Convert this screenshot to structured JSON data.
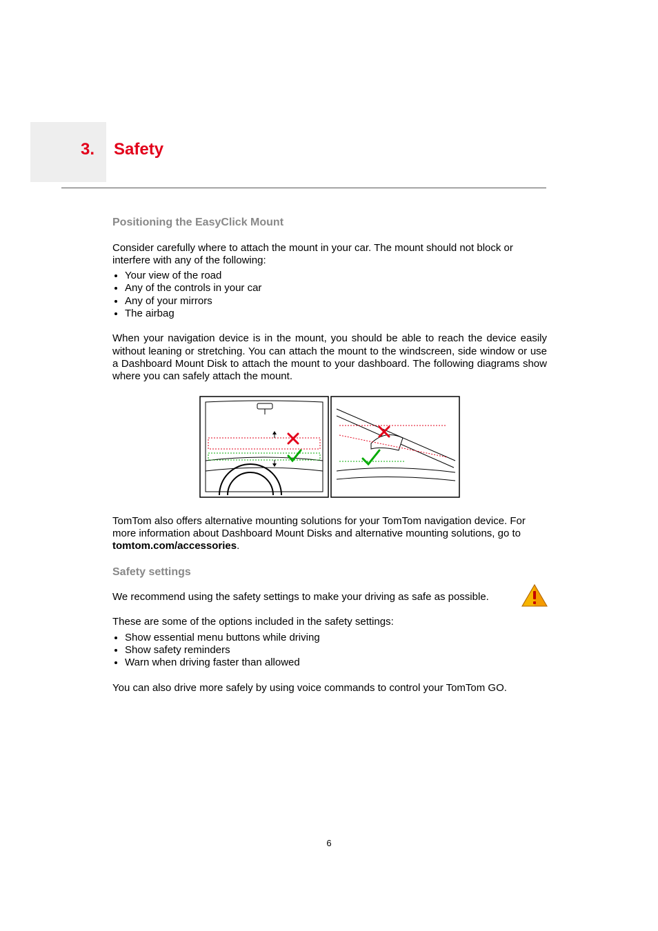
{
  "chapter": {
    "number": "3.",
    "title": "Safety"
  },
  "section1": {
    "heading": "Positioning the EasyClick Mount",
    "intro": "Consider carefully where to attach the mount in your car. The mount should not block or interfere with any of the following:",
    "bullets": [
      "Your view of the road",
      "Any of the controls in your car",
      "Any of your mirrors",
      "The airbag"
    ],
    "body": "When your navigation device is in the mount, you should be able to reach the device easily without leaning or stretching. You can attach the mount to the windscreen, side window or use a Dashboard Mount Disk to attach the mount to your dashboard. The following diagrams show where you can safely attach the mount.",
    "outro_prefix": "TomTom also offers alternative mounting solutions for your TomTom navigation device. For more information about Dashboard Mount Disks and alternative mounting solutions, go to ",
    "outro_link": "tomtom.com/accessories",
    "outro_suffix": "."
  },
  "section2": {
    "heading": "Safety settings",
    "intro": "We recommend using the safety settings to make your driving as safe as possible.",
    "options_intro": "These are some of the options included in the safety settings:",
    "bullets": [
      "Show essential menu buttons while driving",
      "Show safety reminders",
      "Warn when driving faster than allowed"
    ],
    "outro": "You can also drive more safely by using voice commands to control your TomTom GO."
  },
  "page_number": "6"
}
